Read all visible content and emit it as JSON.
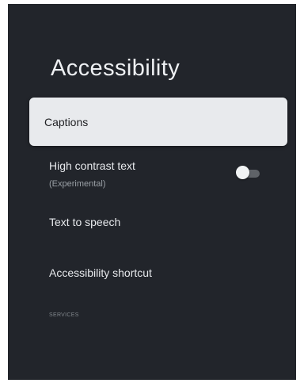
{
  "page": {
    "title": "Accessibility"
  },
  "items": [
    {
      "label": "Captions",
      "focused": true
    },
    {
      "label": "High contrast text",
      "sublabel": "(Experimental)",
      "toggle": "off"
    },
    {
      "label": "Text to speech"
    },
    {
      "label": "Accessibility shortcut"
    }
  ],
  "section_header": "SERVICES",
  "colors": {
    "background": "#22252b",
    "focused_item": "#e8eaed",
    "text": "#e7e9ec",
    "secondary_text": "#9aa0a6"
  }
}
